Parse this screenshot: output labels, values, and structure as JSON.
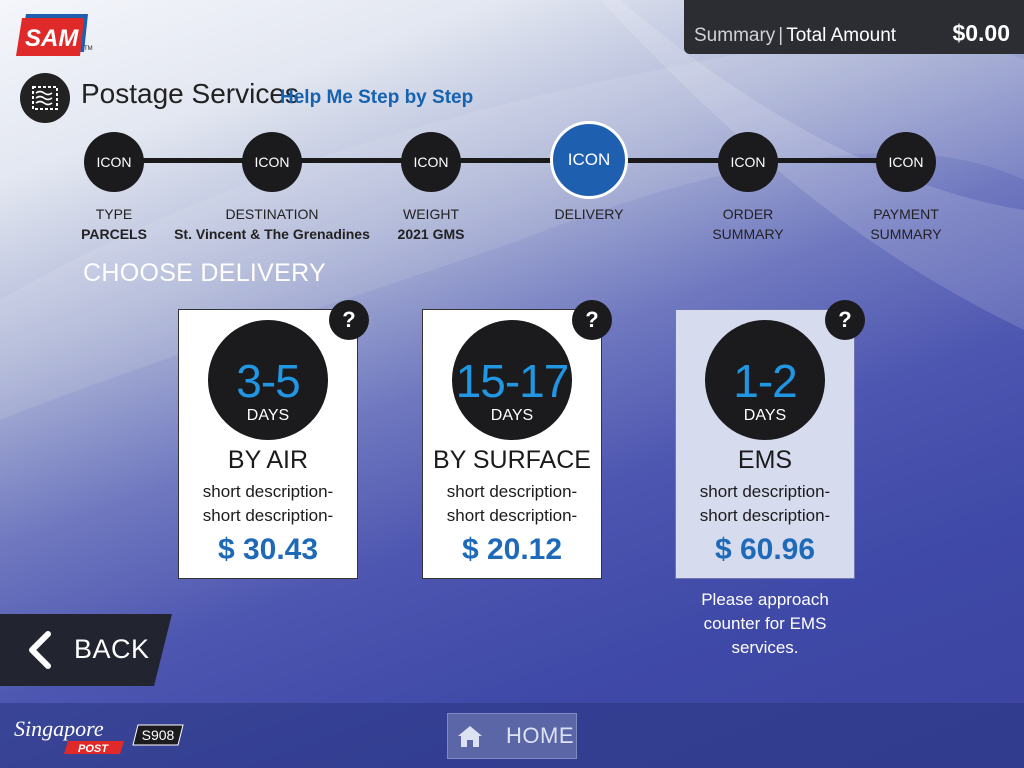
{
  "brand": {
    "logo_text": "SAM",
    "logo_tm": "TM"
  },
  "summary": {
    "label": "Summary",
    "separator": "|",
    "title": "Total Amount",
    "amount": "$0.00"
  },
  "page": {
    "title": "Postage Services",
    "help_link": "Help Me Step by Step",
    "section_icon": "stamp-icon"
  },
  "steps": [
    {
      "icon_text": "ICON",
      "label": "TYPE",
      "value": "PARCELS",
      "active": false
    },
    {
      "icon_text": "ICON",
      "label": "DESTINATION",
      "value": "St. Vincent & The Grenadines",
      "active": false
    },
    {
      "icon_text": "ICON",
      "label": "WEIGHT",
      "value": "2021 GMS",
      "active": false
    },
    {
      "icon_text": "ICON",
      "label": "DELIVERY",
      "value": "",
      "active": true
    },
    {
      "icon_text": "ICON",
      "label": "ORDER",
      "value": "SUMMARY",
      "active": false
    },
    {
      "icon_text": "ICON",
      "label": "PAYMENT",
      "value": "SUMMARY",
      "active": false
    }
  ],
  "choose_heading": "CHOOSE DELIVERY",
  "options": [
    {
      "help": "?",
      "days": "3-5",
      "days_label": "DAYS",
      "method": "BY AIR",
      "desc1": "short description-",
      "desc2": "short description-",
      "price": "$ 30.43"
    },
    {
      "help": "?",
      "days": "15-17",
      "days_label": "DAYS",
      "method": "BY SURFACE",
      "desc1": "short description-",
      "desc2": "short description-",
      "price": "$ 20.12"
    },
    {
      "help": "?",
      "days": "1-2",
      "days_label": "DAYS",
      "method": "EMS",
      "desc1": "short description-",
      "desc2": "short description-",
      "price": "$ 60.96"
    }
  ],
  "ems_note": {
    "line1": "Please approach",
    "line2": "counter for EMS services."
  },
  "back_button": {
    "label": "BACK",
    "icon": "chevron-left-icon"
  },
  "home_button": {
    "label": "HOME",
    "icon": "home-icon"
  },
  "footer": {
    "logo_text": "Singapore",
    "logo_sub": "POST",
    "store_code": "S908"
  },
  "colors": {
    "accent_blue": "#1f6ab8",
    "active_step": "#1f5fb0",
    "days_text": "#2196e3",
    "dark": "#1b1b1d"
  }
}
